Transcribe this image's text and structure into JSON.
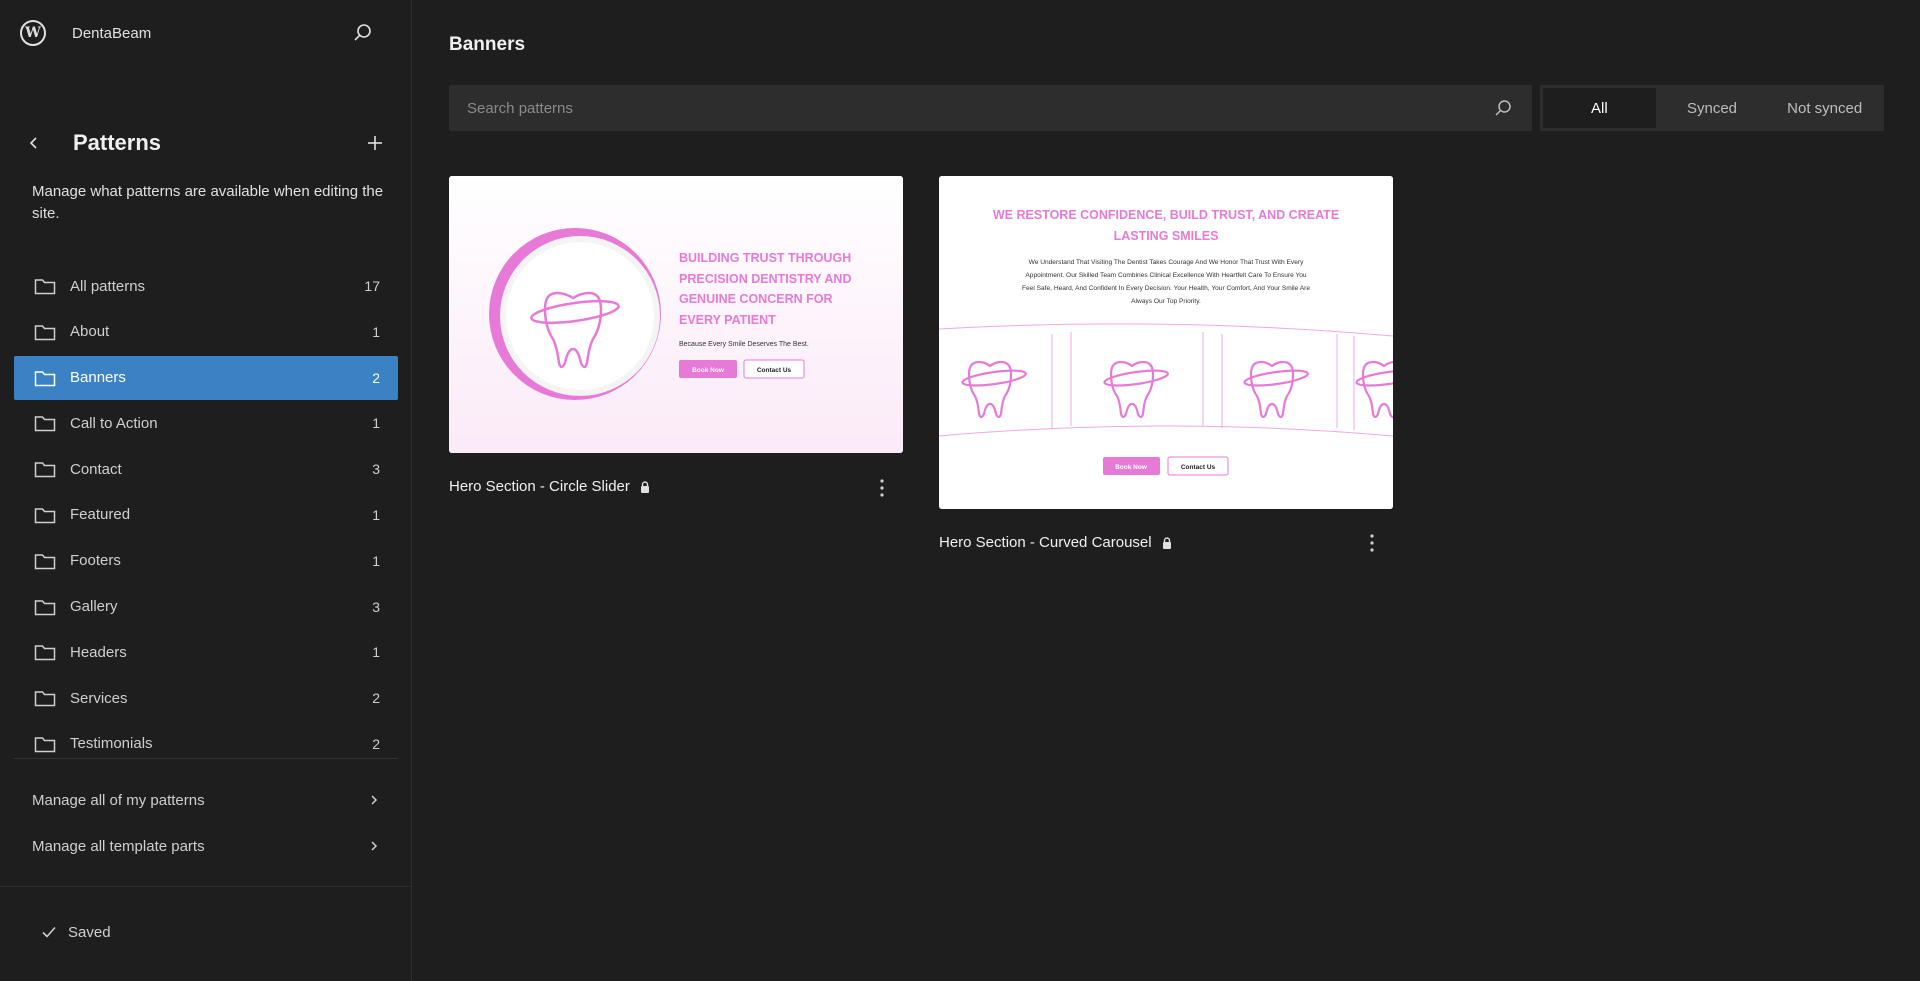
{
  "site": {
    "name": "DentaBeam",
    "logo": "wordpress-logo-icon"
  },
  "sidebar": {
    "title": "Patterns",
    "description": "Manage what patterns are available when editing the site.",
    "categories": [
      {
        "label": "All patterns",
        "count": "17"
      },
      {
        "label": "About",
        "count": "1"
      },
      {
        "label": "Banners",
        "count": "2",
        "active": true
      },
      {
        "label": "Call to Action",
        "count": "1"
      },
      {
        "label": "Contact",
        "count": "3"
      },
      {
        "label": "Featured",
        "count": "1"
      },
      {
        "label": "Footers",
        "count": "1"
      },
      {
        "label": "Gallery",
        "count": "3"
      },
      {
        "label": "Headers",
        "count": "1"
      },
      {
        "label": "Services",
        "count": "2"
      },
      {
        "label": "Testimonials",
        "count": "2"
      }
    ],
    "manage_patterns": "Manage all of my patterns",
    "manage_template_parts": "Manage all template parts",
    "saved": "Saved"
  },
  "main": {
    "title": "Banners",
    "search": {
      "placeholder": "Search patterns",
      "value": ""
    },
    "filters": [
      "All",
      "Synced",
      "Not synced"
    ],
    "active_filter": "All"
  },
  "patterns": [
    {
      "title": "Hero Section - Circle Slider",
      "locked": true,
      "preview": {
        "heading": "BUILDING TRUST THROUGH PRECISION DENTISTRY AND GENUINE CONCERN FOR EVERY PATIENT",
        "heading_lines": [
          "BUILDING TRUST THROUGH",
          "PRECISION DENTISTRY AND",
          "GENUINE CONCERN FOR",
          "EVERY PATIENT"
        ],
        "tagline": "Because Every Smile Deserves The Best.",
        "primary_button": "Book Now",
        "secondary_button": "Contact Us"
      }
    },
    {
      "title": "Hero Section - Curved Carousel",
      "locked": true,
      "preview": {
        "heading_lines": [
          "WE RESTORE CONFIDENCE, BUILD TRUST, AND CREATE",
          "LASTING SMILES"
        ],
        "body_lines": [
          "We Understand That Visiting The Dentist Takes Courage And We Honor That Trust With Every",
          "Appointment. Our Skilled Team Combines Clinical Excellence With Heartfelt Care To Ensure You",
          "Feel Safe, Heard, And Confident In Every Decision. Your Health, Your Comfort, And Your Smile Are",
          "Always Our Top Priority."
        ],
        "primary_button": "Book Now",
        "secondary_button": "Contact Us"
      }
    }
  ],
  "colors": {
    "accent": "#3a82c4",
    "brand_pink": "#e77ad6",
    "background": "#1e1e1e",
    "surface": "#2d2d2d"
  }
}
